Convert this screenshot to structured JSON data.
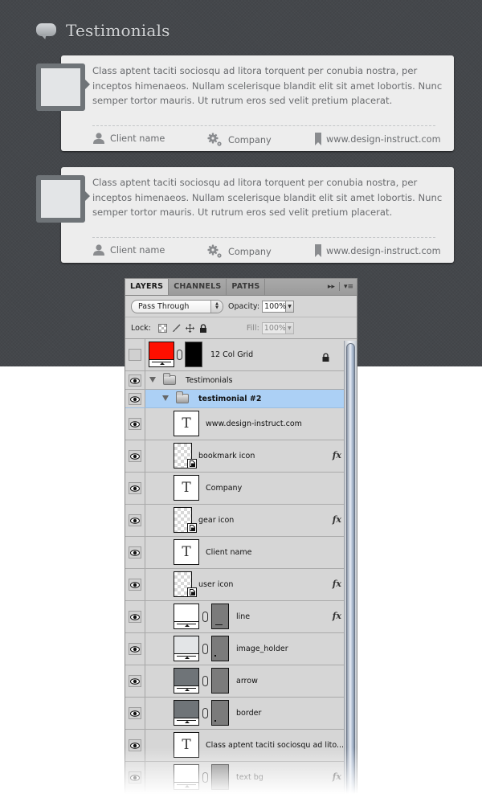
{
  "section": {
    "title": "Testimonials",
    "icon": "speech-bubble-icon"
  },
  "testimonials": [
    {
      "quote": "Class aptent taciti sociosqu ad litora torquent per conubia nostra, per inceptos himenaeos. Nullam scelerisque blandit elit sit amet lobortis. Nunc semper tortor mauris. Ut rutrum eros sed velit pretium placerat.",
      "client": "Client name",
      "company": "Company",
      "website": "www.design-instruct.com"
    },
    {
      "quote": "Class aptent taciti sociosqu ad litora torquent per conubia nostra, per inceptos himenaeos. Nullam scelerisque blandit elit sit amet lobortis. Nunc semper tortor mauris. Ut rutrum eros sed velit pretium placerat.",
      "client": "Client name",
      "company": "Company",
      "website": "www.design-instruct.com"
    }
  ],
  "layers_panel": {
    "tabs": [
      "LAYERS",
      "CHANNELS",
      "PATHS"
    ],
    "active_tab": "LAYERS",
    "blend_mode": "Pass Through",
    "opacity_label": "Opacity:",
    "opacity": "100%",
    "lock_label": "Lock:",
    "fill_label": "Fill:",
    "fill": "100%",
    "layers": [
      {
        "name": "12 Col Grid",
        "type": "shape",
        "visible": false,
        "locked": true,
        "thumb_color": "#ff0f00",
        "mask_color": "#000000"
      },
      {
        "name": "Testimonials",
        "type": "group",
        "visible": true,
        "expanded": true
      },
      {
        "name": "testimonial #2",
        "type": "group",
        "visible": true,
        "expanded": true,
        "selected": true
      },
      {
        "name": "www.design-instruct.com",
        "type": "text",
        "visible": true
      },
      {
        "name": "bookmark icon",
        "type": "smart",
        "visible": true,
        "fx": true
      },
      {
        "name": "Company",
        "type": "text",
        "visible": true
      },
      {
        "name": "gear icon",
        "type": "smart",
        "visible": true,
        "fx": true
      },
      {
        "name": "Client name",
        "type": "text",
        "visible": true
      },
      {
        "name": "user icon",
        "type": "smart",
        "visible": true,
        "fx": true
      },
      {
        "name": "line",
        "type": "shape",
        "visible": true,
        "fx": true,
        "thumb_color": "#ffffff",
        "mask_color": "#7b7b7b"
      },
      {
        "name": "image_holder",
        "type": "shape",
        "visible": true,
        "thumb_color": "#e3e5e7",
        "mask_color": "#7b7b7b"
      },
      {
        "name": "arrow",
        "type": "shape",
        "visible": true,
        "thumb_color": "#6f7478",
        "mask_color": "#7b7b7b"
      },
      {
        "name": "border",
        "type": "shape",
        "visible": true,
        "thumb_color": "#6f7478",
        "mask_color": "#7b7b7b"
      },
      {
        "name": "Class aptent taciti sociosqu ad lito...",
        "type": "text",
        "visible": true
      },
      {
        "name": "text bg",
        "type": "shape",
        "visible": true,
        "fx": true,
        "thumb_color": "#ffffff",
        "mask_color": "#7b7b7b"
      }
    ]
  },
  "colors": {
    "background_dark": "#44474b",
    "card_bg": "#ededed",
    "avatar_border": "#6f7478",
    "avatar_fill": "#e3e5e7",
    "text_gray": "#6a6c6f",
    "layer_selected": "#acd0f5"
  }
}
